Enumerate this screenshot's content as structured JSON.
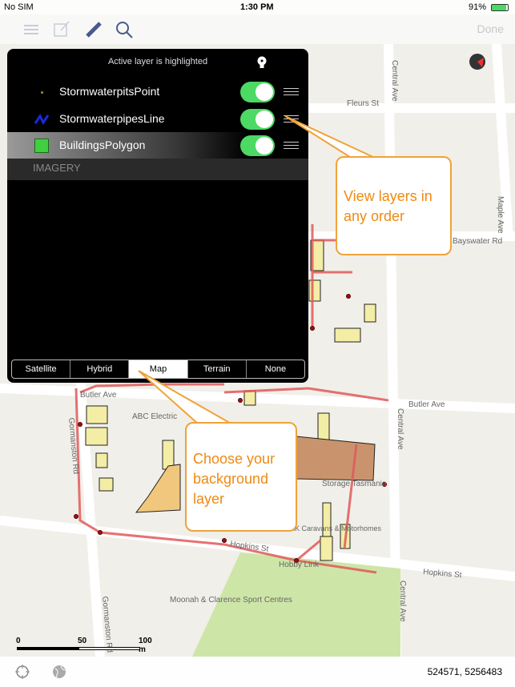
{
  "status": {
    "carrier": "No SIM",
    "time": "1:30 PM",
    "battery": "91%"
  },
  "toolbar": {
    "icons": [
      "list-icon",
      "edit-icon",
      "ruler-icon",
      "search-icon"
    ],
    "done_label": "Done"
  },
  "layers_panel": {
    "header": "Active layer is highlighted",
    "layers": [
      {
        "name": "StormwaterpitsPoint",
        "enabled": true,
        "active": false
      },
      {
        "name": "StormwaterpipesLine",
        "enabled": true,
        "active": false
      },
      {
        "name": "BuildingsPolygon",
        "enabled": true,
        "active": true
      }
    ],
    "section": "IMAGERY",
    "basemaps": [
      "Satellite",
      "Hybrid",
      "Map",
      "Terrain",
      "None"
    ],
    "selected_basemap": "Map"
  },
  "callouts": {
    "reorder": "View layers in any order",
    "background": "Choose your background layer"
  },
  "map": {
    "streets": [
      "Fleurs St",
      "Central Ave",
      "Maple Ave",
      "Bayswater Rd",
      "Butler Ave",
      "Butler Ave",
      "Gormanston Rd",
      "Hopkins St",
      "Hopkins St",
      "Central Ave",
      "Gormanston Rd",
      "Central Ave"
    ],
    "places": [
      "ABC Electric",
      "Storage Tasmania",
      "AK Caravans & Motorhomes",
      "Hobby Link",
      "Moonah & Clarence Sport Centres"
    ]
  },
  "scale": {
    "labels": [
      "0",
      "50",
      "100 m"
    ]
  },
  "bottom": {
    "coordinates": "524571, 5256483"
  },
  "colors": {
    "toggle": "#4cd964",
    "callout_border": "#f0a23a",
    "callout_text": "#ef8a12",
    "pipes": "#e05a5a",
    "buildings": "#f3eda6",
    "park": "#cde6a8"
  }
}
